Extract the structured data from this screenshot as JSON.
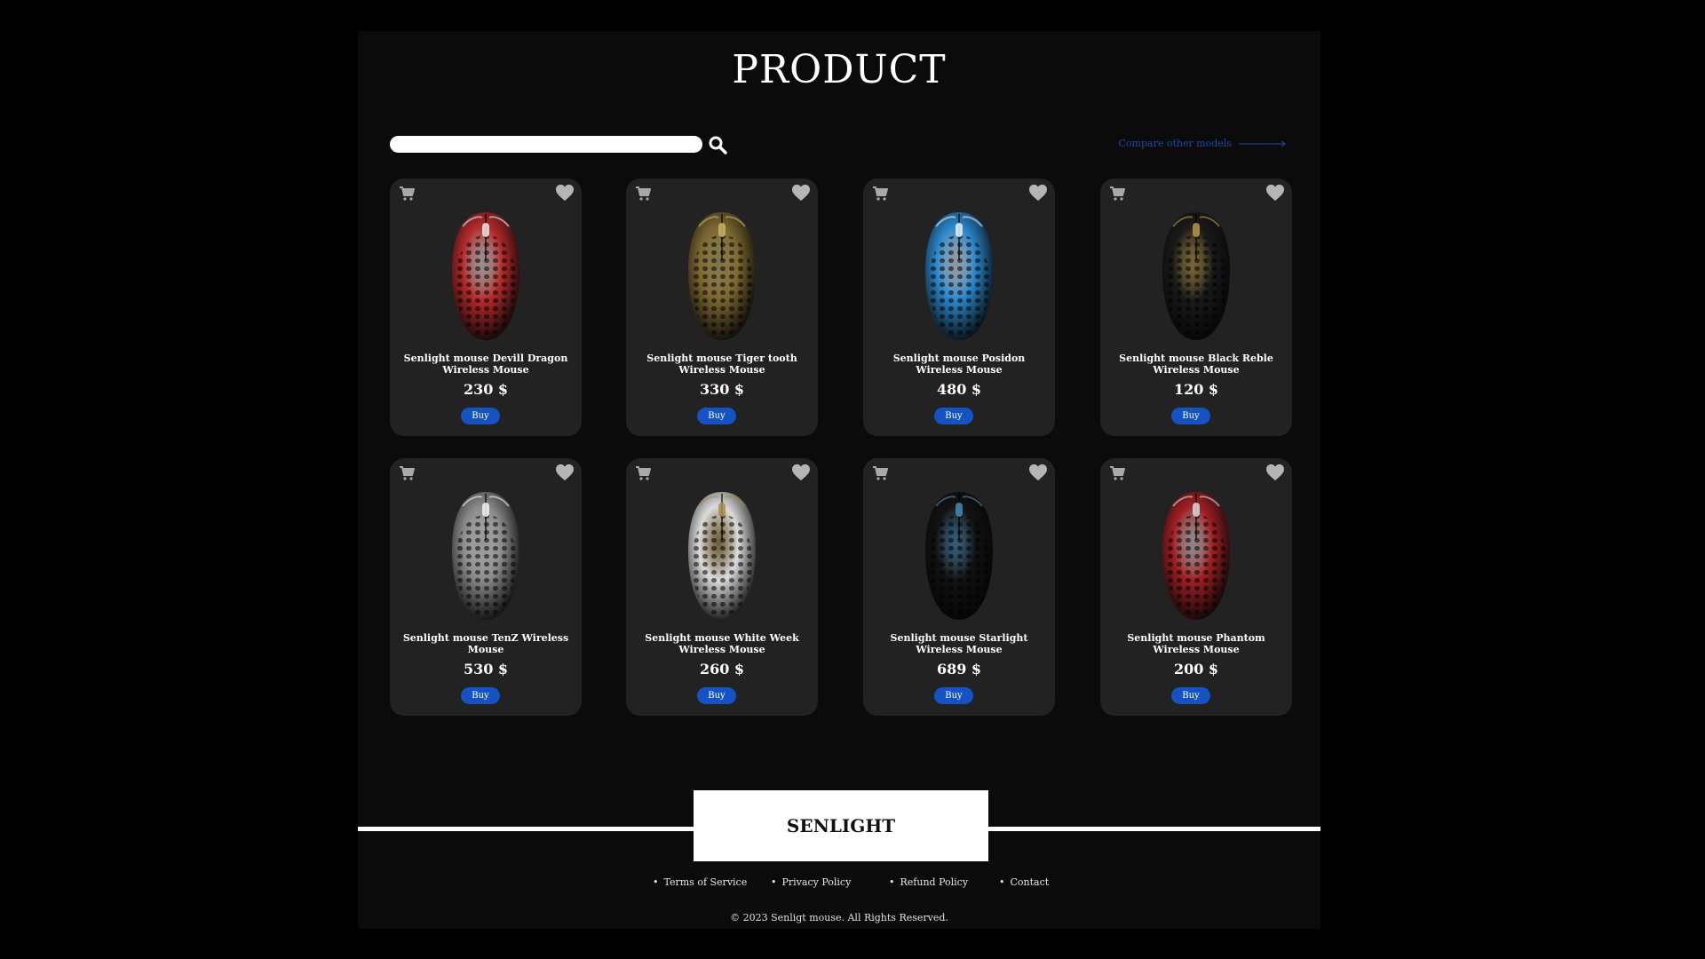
{
  "header": {
    "title": "PRODUCT"
  },
  "toolbar": {
    "search_value": "",
    "compare_label": "Compare other models"
  },
  "products": [
    {
      "name": "Senlight mouse Devill Dragon Wireless Mouse",
      "price": "230 $",
      "buy_label": "Buy",
      "color": "#b52a2a",
      "accent": "#e8e8e8"
    },
    {
      "name": "Senlight mouse Tiger tooth Wireless Mouse",
      "price": "330 $",
      "buy_label": "Buy",
      "color": "#7a6630",
      "accent": "#c9b46a"
    },
    {
      "name": "Senlight mouse Posidon Wireless Mouse",
      "price": "480 $",
      "buy_label": "Buy",
      "color": "#2a86c9",
      "accent": "#e6f2ff"
    },
    {
      "name": "Senlight mouse Black Reble Wireless Mouse",
      "price": "120 $",
      "buy_label": "Buy",
      "color": "#1a1a1a",
      "accent": "#b89a4a"
    },
    {
      "name": "Senlight mouse TenZ Wireless Mouse",
      "price": "530 $",
      "buy_label": "Buy",
      "color": "#8a8a8a",
      "accent": "#f2f2f2"
    },
    {
      "name": "Senlight mouse White Week Wireless Mouse",
      "price": "260 $",
      "buy_label": "Buy",
      "color": "#dcdcdc",
      "accent": "#a88a4a"
    },
    {
      "name": "Senlight mouse Starlight Wireless Mouse",
      "price": "689 $",
      "buy_label": "Buy",
      "color": "#121212",
      "accent": "#4a8ab8"
    },
    {
      "name": "Senlight mouse Phantom Wireless Mouse",
      "price": "200 $",
      "buy_label": "Buy",
      "color": "#a01f24",
      "accent": "#d9d9d9"
    }
  ],
  "footer": {
    "brand": "SENLIGHT",
    "links": [
      "Terms of Service",
      "Privacy Policy",
      "Refund Policy",
      "Contact"
    ],
    "copyright": "© 2023 Senligt mouse. All Rights Reserved."
  },
  "colors": {
    "page_bg": "#0b0b0b",
    "card_bg": "#222222",
    "button": "#1553c4",
    "link": "#1b4aa8"
  },
  "icons": [
    "search-icon",
    "cart-icon",
    "heart-icon",
    "arrow-right-icon"
  ]
}
